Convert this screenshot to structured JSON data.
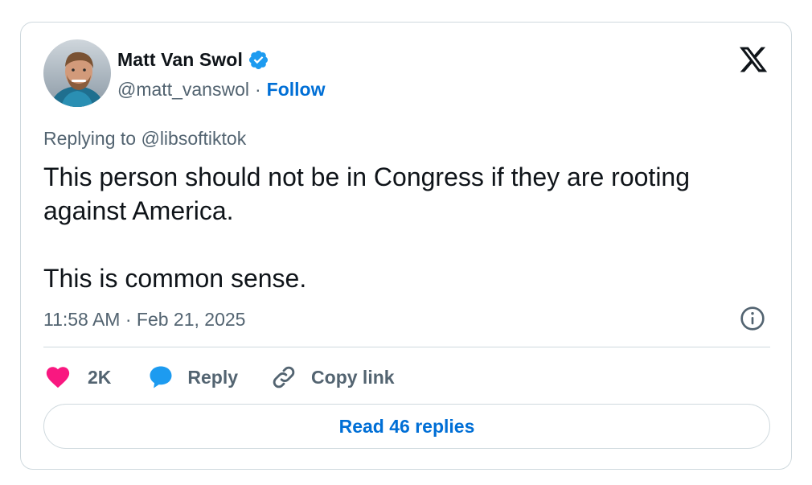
{
  "author": {
    "name": "Matt Van Swol",
    "handle": "@matt_vanswol",
    "separator": "·",
    "follow_label": "Follow",
    "verified": true,
    "verified_color": "#1d9bf0"
  },
  "tweet": {
    "replying_prefix": "Replying to ",
    "replying_to": "@libsoftiktok",
    "text_paragraphs": [
      "This person should not be in Congress if they are rooting against America.",
      "This is common sense."
    ],
    "timestamp": "11:58 AM · Feb 21, 2025"
  },
  "actions": {
    "likes_count": "2K",
    "reply_label": "Reply",
    "copy_link_label": "Copy link"
  },
  "footer": {
    "read_replies_label": "Read 46 replies"
  },
  "icons": {
    "brand_logo": "x-logo-icon",
    "info": "info-icon",
    "like": "heart-icon",
    "reply": "speech-bubble-icon",
    "copy_link": "link-icon",
    "verified": "verified-badge-icon"
  },
  "colors": {
    "text_primary": "#0f1419",
    "text_secondary": "#536471",
    "accent": "#006fd6",
    "like": "#f91880",
    "reply_icon": "#1d9bf0",
    "border": "#cfd9de"
  }
}
